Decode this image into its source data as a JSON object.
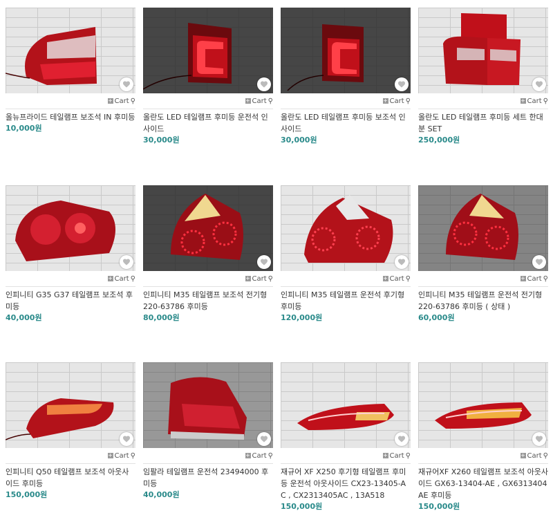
{
  "cart_label": "Cart",
  "products": [
    {
      "title": "올뉴프라이드 테일램프 보조석 IN 후미등",
      "price": "10,000원",
      "bg": "light"
    },
    {
      "title": "올란도 LED 테일램프 후미등 운전석 인사이드",
      "price": "30,000원",
      "bg": "dark"
    },
    {
      "title": "올란도 LED 테일램프 후미등 보조석 인사이드",
      "price": "30,000원",
      "bg": "dark"
    },
    {
      "title": "올란도 LED 테일램프 후미등 세트 한대분 SET",
      "price": "250,000원",
      "bg": "light"
    },
    {
      "title": "인피니티 G35 G37 테일램프 보조석 후미등",
      "price": "40,000원",
      "bg": "light"
    },
    {
      "title": "인피니티 M35 테일램프 보조석 전기형 220-63786 후미등",
      "price": "80,000원",
      "bg": "dark"
    },
    {
      "title": "인피니티 M35 테일램프 운전석 후기형 후미등",
      "price": "120,000원",
      "bg": "light"
    },
    {
      "title": "인피니티 M35 테일램프 운전석 전기형 220-63786 후미등 ( 상태 )",
      "price": "60,000원",
      "bg": "dark"
    },
    {
      "title": "인피니티 Q50 테일램프 보조석 아웃사이드 후미등",
      "price": "150,000원",
      "bg": "light"
    },
    {
      "title": "임팔라 테일램프 운전석 23494000 후미등",
      "price": "40,000원",
      "bg": "light"
    },
    {
      "title": "재규어 XF X250 후기형 테일램프 후미등 운전석 아웃사이드 CX23-13405-AC , CX2313405AC , 13A518",
      "price": "150,000원",
      "bg": "light"
    },
    {
      "title": "재규어XF X260 테일램프 보조석 아웃사이드 GX63-13404-AE , GX6313404AE 후미등",
      "price": "150,000원",
      "bg": "light"
    }
  ]
}
